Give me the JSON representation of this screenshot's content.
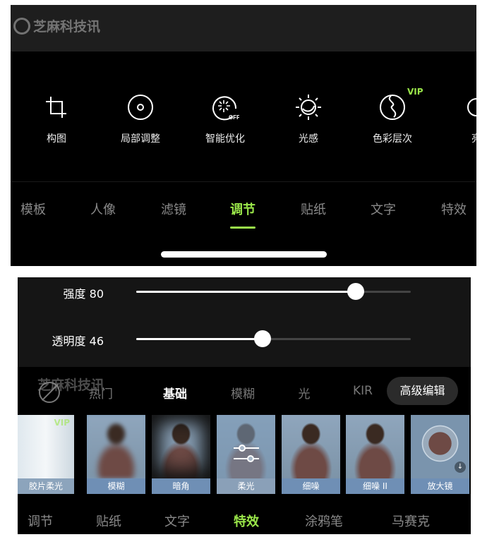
{
  "watermark": "芝麻科技讯",
  "top_panel": {
    "tools": [
      {
        "label": "构图",
        "icon": "crop-icon"
      },
      {
        "label": "局部调整",
        "icon": "target-circle-icon"
      },
      {
        "label": "智能优化",
        "icon": "auto-enhance-off-icon",
        "badge": "OFF"
      },
      {
        "label": "光感",
        "icon": "sun-icon"
      },
      {
        "label": "色彩层次",
        "icon": "color-layer-icon",
        "vip": "VIP"
      },
      {
        "label": "亮",
        "icon": "brightness-icon"
      }
    ],
    "tabs": [
      "模板",
      "人像",
      "滤镜",
      "调节",
      "贴纸",
      "文字",
      "特效"
    ],
    "active_tab": "调节"
  },
  "bottom_panel": {
    "sliders": [
      {
        "label": "强度 80",
        "value": 80
      },
      {
        "label": "透明度 46",
        "value": 46
      }
    ],
    "categories": [
      "热门",
      "基础",
      "模糊",
      "光",
      "KIR"
    ],
    "active_category": "基础",
    "advanced_button": "高级编辑",
    "effects": [
      {
        "label": "胶片柔光",
        "vip": "VIP"
      },
      {
        "label": "模糊"
      },
      {
        "label": "暗角"
      },
      {
        "label": "柔光"
      },
      {
        "label": "细噪"
      },
      {
        "label": "细噪 II"
      },
      {
        "label": "放大镜"
      }
    ],
    "tabs": [
      "调节",
      "贴纸",
      "文字",
      "特效",
      "涂鸦笔",
      "马赛克"
    ],
    "active_tab": "特效"
  },
  "colors": {
    "accent": "#9be84a",
    "caption": "#6f8fb5"
  }
}
